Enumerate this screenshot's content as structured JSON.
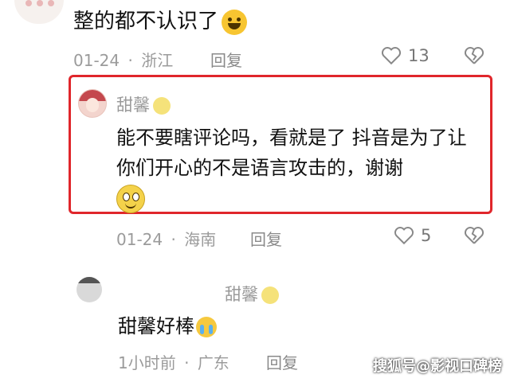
{
  "comment1": {
    "text": "整的都不认识了",
    "date": "01-24",
    "separator": "·",
    "location": "浙江",
    "reply_label": "回复",
    "likes": "13"
  },
  "comment2": {
    "username": "甜馨",
    "text": "能不要瞎评论吗，看就是了 抖音是为了让你们开心的不是语言攻击的，谢谢",
    "date": "01-24",
    "separator": "·",
    "location": "海南",
    "reply_label": "回复",
    "likes": "5"
  },
  "comment3": {
    "reply_to": "甜馨",
    "text": "甜馨好棒",
    "time": "1小时前",
    "separator": "·",
    "location": "广东",
    "reply_label": "回复"
  },
  "watermark": "搜狐号@影视口碑榜",
  "colors": {
    "highlight_box": "#e0262b",
    "meta_gray": "#9b9b9b"
  },
  "icons": [
    "heart-icon",
    "dislike-heart-icon",
    "laughing-emoji-icon",
    "wink-emoji-icon",
    "smile-emoji-icon",
    "crying-emoji-icon"
  ]
}
